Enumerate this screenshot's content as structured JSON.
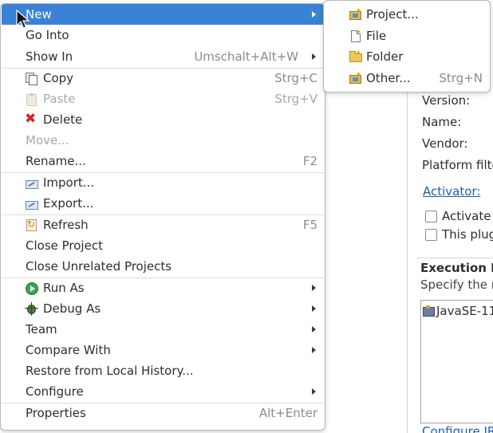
{
  "editor": {
    "version_label": "Version:",
    "name_label": "Name:",
    "vendor_label": "Vendor:",
    "platform_filter_label": "Platform filte",
    "activator_link": "Activator:",
    "activate_checkbox_label": "Activate",
    "this_plugin_checkbox_label": "This plug",
    "execution_section_title": "Execution E",
    "execution_section_desc": "Specify the r",
    "environment_item": "JavaSE-11",
    "configure_link": "Configure JR"
  },
  "context_menu": {
    "items": [
      {
        "label": "New",
        "accel": "",
        "submenu": true,
        "icon": "none"
      },
      {
        "label": "Go Into",
        "accel": "",
        "submenu": false,
        "icon": "none"
      },
      {
        "label": "Show In",
        "accel": "Umschalt+Alt+W",
        "submenu": true,
        "icon": "none"
      },
      {
        "label": "Copy",
        "accel": "Strg+C",
        "submenu": false,
        "icon": "copy-icon"
      },
      {
        "label": "Paste",
        "accel": "Strg+V",
        "submenu": false,
        "icon": "paste-icon",
        "disabled": true
      },
      {
        "label": "Delete",
        "accel": "",
        "submenu": false,
        "icon": "delete-icon"
      },
      {
        "label": "Move...",
        "accel": "",
        "submenu": false,
        "icon": "none",
        "disabled": true
      },
      {
        "label": "Rename...",
        "accel": "F2",
        "submenu": false,
        "icon": "none"
      },
      {
        "label": "Import...",
        "accel": "",
        "submenu": false,
        "icon": "import-icon"
      },
      {
        "label": "Export...",
        "accel": "",
        "submenu": false,
        "icon": "export-icon"
      },
      {
        "label": "Refresh",
        "accel": "F5",
        "submenu": false,
        "icon": "refresh-icon"
      },
      {
        "label": "Close Project",
        "accel": "",
        "submenu": false,
        "icon": "none"
      },
      {
        "label": "Close Unrelated Projects",
        "accel": "",
        "submenu": false,
        "icon": "none"
      },
      {
        "label": "Run As",
        "accel": "",
        "submenu": true,
        "icon": "run-icon"
      },
      {
        "label": "Debug As",
        "accel": "",
        "submenu": true,
        "icon": "debug-icon"
      },
      {
        "label": "Team",
        "accel": "",
        "submenu": true,
        "icon": "none"
      },
      {
        "label": "Compare With",
        "accel": "",
        "submenu": true,
        "icon": "none"
      },
      {
        "label": "Restore from Local History...",
        "accel": "",
        "submenu": false,
        "icon": "none"
      },
      {
        "label": "Configure",
        "accel": "",
        "submenu": true,
        "icon": "none"
      },
      {
        "label": "Properties",
        "accel": "Alt+Enter",
        "submenu": false,
        "icon": "none"
      }
    ]
  },
  "new_submenu": {
    "items": [
      {
        "label": "Project...",
        "accel": "",
        "icon": "new-project-icon"
      },
      {
        "label": "File",
        "accel": "",
        "icon": "new-file-icon"
      },
      {
        "label": "Folder",
        "accel": "",
        "icon": "new-folder-icon"
      },
      {
        "label": "Other...",
        "accel": "Strg+N",
        "icon": "new-other-icon"
      }
    ]
  },
  "colors": {
    "selection": "#3a82d6",
    "link": "#1f5fae",
    "disabled_text": "#a8a8a8",
    "accelerator_text": "#8b8b8b"
  }
}
